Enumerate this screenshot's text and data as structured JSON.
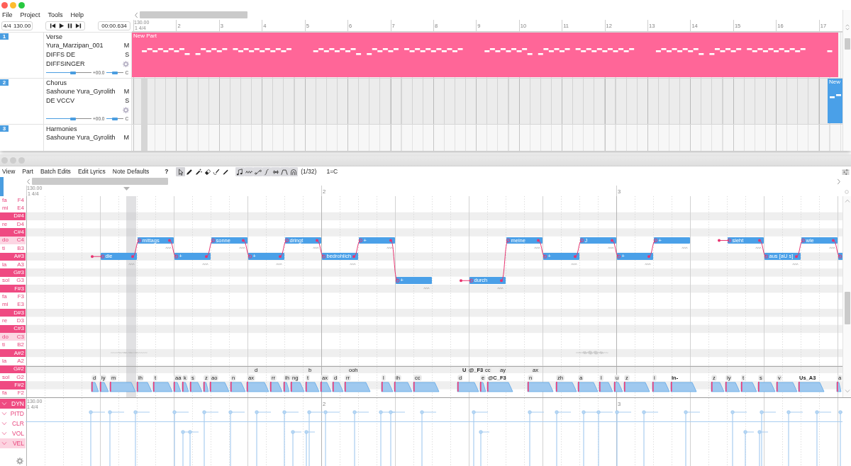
{
  "arrange_window": {
    "menu": [
      "File",
      "Project",
      "Tools",
      "Help"
    ],
    "time_signature": "4/4",
    "tempo": "130.00",
    "time": "00:00.634",
    "ruler": {
      "tempo": "130.00",
      "start": "1 4/4",
      "bars": [
        "2",
        "3",
        "4",
        "5",
        "6",
        "7",
        "8",
        "9",
        "10",
        "11",
        "12",
        "13",
        "14",
        "15",
        "16",
        "17"
      ]
    },
    "tracks": [
      {
        "number": "1",
        "name": "Verse",
        "singer": "Yura_Marzipan_001",
        "mute": "M",
        "phonemizer": "DIFFS DE",
        "solo": "S",
        "renderer": "DIFFSINGER",
        "volume": {
          "level": 0.6,
          "reading": "+00.0"
        },
        "pan": {
          "level": 0.45,
          "reading": "C"
        },
        "parts": [
          {
            "name": "New Part",
            "color": "#ff6698"
          }
        ]
      },
      {
        "number": "2",
        "name": "Chorus",
        "singer": "Sashoune Yura_Gyrolith",
        "mute": "M",
        "phonemizer": "DE VCCV",
        "solo": "S",
        "volume": {
          "level": 0.6,
          "reading": "+00.0"
        },
        "pan": {
          "level": 0.45,
          "reading": "C"
        },
        "parts": [
          {
            "name": "New",
            "color": "#4aa0e8"
          }
        ]
      },
      {
        "number": "3",
        "name": "Harmonies",
        "singer": "Sashoune Yura_Gyrolith",
        "mute": "M"
      }
    ]
  },
  "editor_window": {
    "menu": [
      "View",
      "Part",
      "Batch Edits",
      "Edit Lyrics",
      "Note Defaults"
    ],
    "help": "?",
    "edit_tools": [
      {
        "selected": true
      },
      {
        "selected": false
      },
      {
        "selected": false
      },
      {
        "selected": false
      },
      {
        "selected": false
      },
      {
        "selected": false
      }
    ],
    "view_toggles": [
      {
        "on": true
      },
      {
        "on": true
      },
      {
        "on": true
      },
      {
        "on": true
      },
      {
        "on": true
      },
      {
        "on": true
      },
      {
        "on": true
      }
    ],
    "snap": "(1/32)",
    "key": "1=C",
    "ruler": {
      "tempo": "130.00",
      "start": "1 4/4",
      "bars": [
        "2",
        "3"
      ]
    },
    "keys": [
      {
        "solfege": "fa",
        "name": "F4",
        "kind": "white"
      },
      {
        "solfege": "mi",
        "name": "E4",
        "kind": "white"
      },
      {
        "name": "D#4",
        "kind": "black"
      },
      {
        "solfege": "re",
        "name": "D4",
        "kind": "white"
      },
      {
        "name": "C#4",
        "kind": "black"
      },
      {
        "solfege": "do",
        "name": "C4",
        "kind": "tonic"
      },
      {
        "solfege": "ti",
        "name": "B3",
        "kind": "white"
      },
      {
        "name": "A#3",
        "kind": "black"
      },
      {
        "solfege": "la",
        "name": "A3",
        "kind": "white"
      },
      {
        "name": "G#3",
        "kind": "black"
      },
      {
        "solfege": "sol",
        "name": "G3",
        "kind": "white"
      },
      {
        "name": "F#3",
        "kind": "black"
      },
      {
        "solfege": "fa",
        "name": "F3",
        "kind": "white"
      },
      {
        "solfege": "mi",
        "name": "E3",
        "kind": "white"
      },
      {
        "name": "D#3",
        "kind": "black"
      },
      {
        "solfege": "re",
        "name": "D3",
        "kind": "white"
      },
      {
        "name": "C#3",
        "kind": "black"
      },
      {
        "solfege": "do",
        "name": "C3",
        "kind": "tonic"
      },
      {
        "solfege": "ti",
        "name": "B2",
        "kind": "white"
      },
      {
        "name": "A#2",
        "kind": "black"
      },
      {
        "solfege": "la",
        "name": "A2",
        "kind": "white"
      },
      {
        "name": "G#2",
        "kind": "black"
      },
      {
        "solfege": "sol",
        "name": "G2",
        "kind": "white"
      },
      {
        "name": "F#2",
        "kind": "black"
      },
      {
        "solfege": "fa",
        "name": "F2",
        "kind": "white"
      }
    ],
    "notes": [
      {
        "lyric": "die",
        "selected": false
      },
      {
        "lyric": "mittags",
        "selected": false
      },
      {
        "lyric": "+",
        "selected": false
      },
      {
        "lyric": "sonne",
        "selected": false
      },
      {
        "lyric": "+",
        "selected": false
      },
      {
        "lyric": "dringt",
        "selected": false
      },
      {
        "lyric": "bedrohlich",
        "selected": false
      },
      {
        "lyric": "+",
        "selected": false
      },
      {
        "lyric": "+",
        "selected": false
      },
      {
        "lyric": "durch",
        "selected": false
      },
      {
        "lyric": "meine",
        "selected": false
      },
      {
        "lyric": "+",
        "selected": false
      },
      {
        "lyric": "J",
        "selected": false
      },
      {
        "lyric": "+",
        "selected": false
      },
      {
        "lyric": "+",
        "selected": false
      },
      {
        "lyric": "sieht",
        "selected": false
      },
      {
        "lyric": "aus [aU s]",
        "selected": false
      },
      {
        "lyric": "wie",
        "selected": false
      },
      {
        "selected": false
      }
    ],
    "phonemes_upper": [
      {
        "text": "d",
        "bold": false
      },
      {
        "text": "b",
        "bold": false
      },
      {
        "text": "ooh",
        "bold": false
      },
      {
        "text": "U",
        "bold": true
      },
      {
        "text": "@_F3",
        "bold": true
      },
      {
        "text": "cc",
        "bold": false
      },
      {
        "text": "ay",
        "bold": false
      },
      {
        "text": "ax",
        "bold": false
      }
    ],
    "phonemes_lower": [
      {
        "text": "d",
        "bold": false
      },
      {
        "text": "iy",
        "bold": false
      },
      {
        "text": "m",
        "bold": false
      },
      {
        "text": "ih",
        "bold": false
      },
      {
        "text": "t",
        "bold": false
      },
      {
        "text": "aa",
        "bold": false
      },
      {
        "text": "k",
        "bold": false
      },
      {
        "text": "s",
        "bold": false
      },
      {
        "text": "z",
        "bold": false
      },
      {
        "text": "ao",
        "bold": false
      },
      {
        "text": "n",
        "bold": false
      },
      {
        "text": "ax",
        "bold": false
      },
      {
        "text": "rr",
        "bold": false
      },
      {
        "text": "ih",
        "bold": false
      },
      {
        "text": "ng",
        "bold": false
      },
      {
        "text": "t",
        "bold": false
      },
      {
        "text": "ax",
        "bold": false
      },
      {
        "text": "d",
        "bold": false
      },
      {
        "text": "rr",
        "bold": false
      },
      {
        "text": "l",
        "bold": false
      },
      {
        "text": "ih",
        "bold": false
      },
      {
        "text": "cc",
        "bold": false
      },
      {
        "text": "d",
        "bold": false
      },
      {
        "text": "e",
        "bold": false
      },
      {
        "text": "@C_F3",
        "bold": true
      },
      {
        "text": "n",
        "bold": false
      },
      {
        "text": "zh",
        "bold": false
      },
      {
        "text": "a",
        "bold": false
      },
      {
        "text": "l",
        "bold": false
      },
      {
        "text": "u",
        "bold": false
      },
      {
        "text": "z",
        "bold": false
      },
      {
        "text": "i",
        "bold": false
      },
      {
        "text": "In-",
        "bold": true
      },
      {
        "text": "z",
        "bold": false
      },
      {
        "text": "iy",
        "bold": false
      },
      {
        "text": "t",
        "bold": false
      },
      {
        "text": "s",
        "bold": false
      },
      {
        "text": "v",
        "bold": false
      },
      {
        "text": "Us_A3",
        "bold": true
      },
      {
        "text": "a",
        "bold": false
      }
    ],
    "expressions": [
      {
        "label": "DYN",
        "selected": true,
        "secondary": false
      },
      {
        "label": "PITD",
        "selected": false,
        "secondary": false
      },
      {
        "label": "CLR",
        "selected": false,
        "secondary": false
      },
      {
        "label": "VOL",
        "selected": false,
        "secondary": false
      },
      {
        "label": "VEL",
        "selected": false,
        "secondary": true
      }
    ],
    "expression_ruler": {
      "tempo": "130.00",
      "start": "1 4/4",
      "bars": [
        "2",
        "3"
      ]
    }
  }
}
